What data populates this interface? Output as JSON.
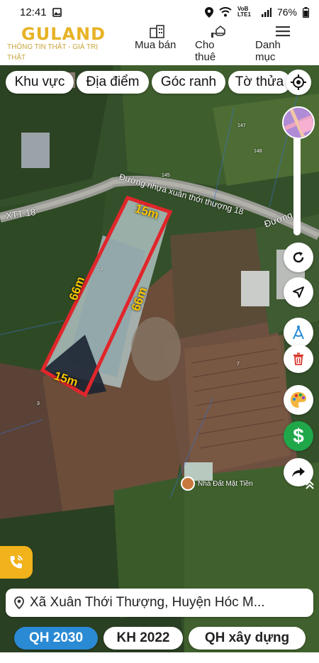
{
  "status_bar": {
    "time": "12:41",
    "network": "VoB LTE1",
    "battery": "76%"
  },
  "header": {
    "logo": "GULAND",
    "tagline": "THÔNG TIN THẬT - GIÁ TRỊ THẬT",
    "nav": [
      {
        "label": "Mua bán",
        "icon": "building-icon"
      },
      {
        "label": "Cho thuê",
        "icon": "hand-house-icon"
      },
      {
        "label": "Danh mục",
        "icon": "menu-icon"
      }
    ]
  },
  "filters": [
    "Khu vực",
    "Địa điểm",
    "Góc ranh",
    "Tờ thửa"
  ],
  "map": {
    "road_labels": [
      "Đường nhựa xuân thới thượng 18",
      "Đường",
      "XTT 18"
    ],
    "parcel_numbers": [
      "147",
      "148",
      "145",
      "2",
      "3",
      "7"
    ],
    "measurements": [
      "15m",
      "66m",
      "66m",
      "15m"
    ],
    "poi_label": "Nhà Đất Mặt Tiền"
  },
  "address": "Xã Xuân Thới Thượng, Huyện Hóc M...",
  "tags": [
    {
      "label": "QH 2030",
      "active": true
    },
    {
      "label": "KH 2022",
      "active": false
    },
    {
      "label": "QH xây dựng",
      "active": false
    }
  ],
  "colors": {
    "brand": "#e7b225",
    "accent": "#2a8ad4",
    "plot_border": "#e0262b",
    "measure": "#f7c400",
    "money": "#1fa74a",
    "delete": "#d9342b"
  }
}
